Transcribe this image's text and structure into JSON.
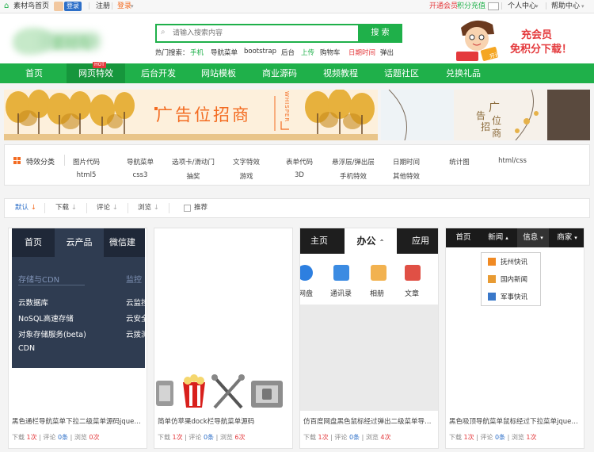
{
  "topbar": {
    "home_link": "素材鸟首页",
    "login_badge": "登录",
    "register": "注册",
    "login": "登录",
    "vip": "开通会员",
    "recharge": "积分充值",
    "user_center": "个人中心",
    "help_center": "帮助中心"
  },
  "header": {
    "logo_text": "素材鸟",
    "search_placeholder": "请输入搜索内容",
    "search_button": "搜 索",
    "hot_label": "热门搜索：",
    "hot_items": [
      "手机",
      "导航菜单",
      "bootstrap",
      "后台",
      "上传",
      "购物车",
      "日期时间",
      "弹出"
    ],
    "promo_line1": "充会员",
    "promo_line2": "免积分下载！",
    "mascot_sign": "开通"
  },
  "nav": {
    "items": [
      "首页",
      "网页特效",
      "后台开发",
      "网站模板",
      "商业源码",
      "视频教程",
      "话题社区",
      "兑换礼品"
    ],
    "hot_badge": "HOT"
  },
  "banner": {
    "left_text": "广告位招商",
    "whisper": "WHISPER",
    "right_chars": [
      "广",
      "告",
      "位",
      "招",
      "商"
    ]
  },
  "categories": {
    "label": "特效分类",
    "row1": [
      "图片代码",
      "导航菜单",
      "选项卡/滑动门",
      "文字特效",
      "表单代码",
      "悬浮层/弹出层",
      "日期时间",
      "统计图",
      "html/css"
    ],
    "row2": [
      "html5",
      "css3",
      "抽奖",
      "游戏",
      "3D",
      "手机特效",
      "其他特效"
    ]
  },
  "sortbar": {
    "items": [
      "默认",
      "下载",
      "评论",
      "浏览"
    ],
    "recommend": "推荐"
  },
  "stats_labels": {
    "download": "下载",
    "comment": "评论",
    "view": "浏览"
  },
  "cards": [
    {
      "title": "黑色通栏导航菜单下拉二级菜单源码jquery...",
      "downloads": "1次",
      "comments": "0条",
      "views": "0次"
    },
    {
      "title": "简单仿苹果dock栏导航菜单源码",
      "downloads": "1次",
      "comments": "0条",
      "views": "6次"
    },
    {
      "title": "仿百度网盘黑色鼠标经过弹出二级菜单导航...",
      "downloads": "1次",
      "comments": "0条",
      "views": "4次"
    },
    {
      "title": "黑色吸顶导航菜单鼠标经过下拉菜单jquery...",
      "downloads": "1次",
      "comments": "0条",
      "views": "1次"
    }
  ],
  "card1": {
    "tabs": [
      "首页",
      "云产品",
      "微信建"
    ],
    "section1": "存储与CDN",
    "section2": "监控",
    "items": [
      "云数据库",
      "NoSQL高速存储",
      "对象存储服务(beta)",
      "CDN"
    ],
    "right_items": [
      "云监控",
      "云安全",
      "云拨测"
    ]
  },
  "card3": {
    "tabs": [
      "主页",
      "办公",
      "应用"
    ],
    "icons": [
      "网盘",
      "通讯录",
      "相册",
      "文章"
    ]
  },
  "card4": {
    "tabs": [
      "首页",
      "新闻",
      "信息",
      "商家"
    ],
    "dropdown": [
      "抚州快讯",
      "国内新闻",
      "军事快讯"
    ]
  },
  "colors": {
    "brand_green": "#1fb04a",
    "nav_active": "#16963c",
    "orange": "#f36b21",
    "red": "#e4393c"
  }
}
